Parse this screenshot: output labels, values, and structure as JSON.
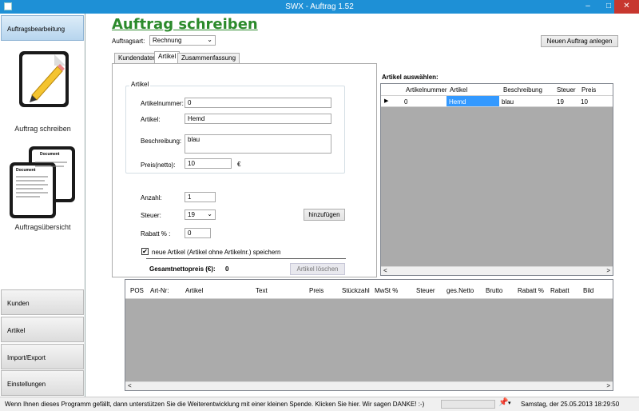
{
  "window": {
    "title": "SWX - Auftrag 1.52",
    "minimize_glyph": "–",
    "maximize_glyph": "□",
    "close_glyph": "✕"
  },
  "nav": {
    "auftragsbearbeitung": "Auftragsbearbeitung",
    "auftrag_schreiben": "Auftrag schreiben",
    "auftragsuebersicht": "Auftragsübersicht",
    "doc_title": "Document",
    "kunden": "Kunden",
    "artikel": "Artikel",
    "import_export": "Import/Export",
    "einstellungen": "Einstellungen"
  },
  "header": {
    "title": "Auftrag schreiben",
    "auftragsart_label": "Auftragsart:",
    "auftragsart_value": "Rechnung",
    "new_order_button": "Neuen Auftrag anlegen"
  },
  "tabs": {
    "kundendaten": "Kundendaten",
    "artikel": "Artikel",
    "zusammenfassung": "Zusammenfassung"
  },
  "artikel_form": {
    "group_title": "Artikel",
    "artikelnummer_label": "Artikelnummer:",
    "artikelnummer_value": "0",
    "artikel_label": "Artikel:",
    "artikel_value": "Hemd",
    "beschreibung_label": "Beschreibung:",
    "beschreibung_value": "blau",
    "preis_label": "Preis(netto):",
    "preis_value": "10",
    "currency": "€",
    "anzahl_label": "Anzahl:",
    "anzahl_value": "1",
    "steuer_label": "Steuer:",
    "steuer_value": "19",
    "rabatt_label": "Rabatt % :",
    "rabatt_value": "0",
    "add_button": "hinzufügen",
    "checkbox_label": "neue Artikel (Artikel ohne Artikelnr.) speichern",
    "total_label": "Gesamtnettopreis (€):",
    "total_value": "0",
    "delete_button": "Artikel löschen"
  },
  "article_select": {
    "title": "Artikel auswählen:",
    "columns": [
      "Artikelnummer",
      "Artikel",
      "Beschreibung",
      "Steuer",
      "Preis"
    ],
    "rows": [
      {
        "indicator": "▶",
        "cells": [
          "0",
          "Hemd",
          "blau",
          "19",
          "10"
        ]
      }
    ],
    "scroll_left": "<",
    "scroll_right": ">"
  },
  "order_grid": {
    "columns": [
      "POS",
      "Art-Nr:",
      "Artikel",
      "Text",
      "Preis",
      "Stückzahl",
      "MwSt %",
      "Steuer",
      "ges.Netto",
      "Brutto",
      "Rabatt %",
      "Rabatt",
      "Bild"
    ],
    "scroll_left": "<",
    "scroll_right": ">"
  },
  "statusbar": {
    "message": "Wenn Ihnen dieses Programm gefällt, dann unterstützen Sie die Weiterentwicklung mit einer kleinen Spende. Klicken Sie hier.  Wir sagen DANKE!  :-)",
    "datetime": "Samstag, der 25.05.2013 18:29:50"
  },
  "colors": {
    "titlebar": "#1e90d6",
    "heading": "#2b8a2b",
    "selection": "#3399ff",
    "close": "#c7372f"
  }
}
